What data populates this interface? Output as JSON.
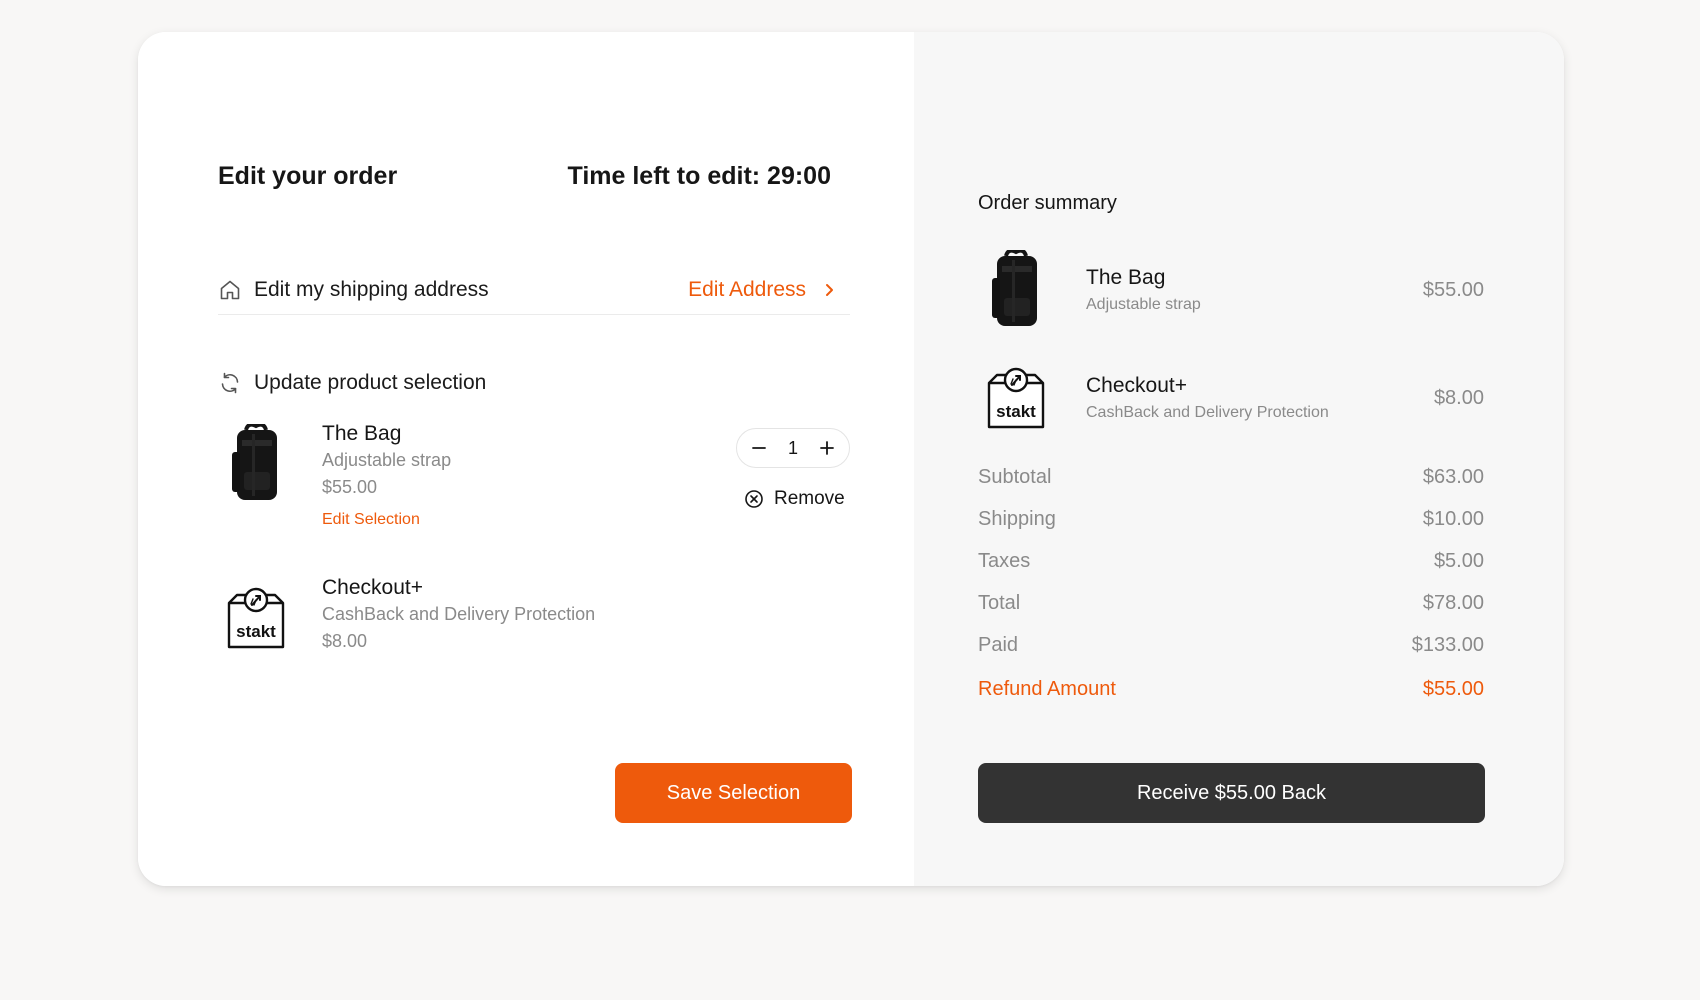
{
  "left": {
    "title": "Edit your order",
    "timer": "Time left to edit: 29:00",
    "shipping": {
      "label": "Edit my shipping address",
      "link": "Edit Address"
    },
    "update": {
      "label": "Update product selection"
    },
    "items": [
      {
        "name": "The Bag",
        "sub": "Adjustable strap",
        "price": "$55.00",
        "edit": "Edit Selection",
        "qty": "1",
        "remove": "Remove"
      },
      {
        "name": "Checkout+",
        "sub": "CashBack and Delivery Protection",
        "price": "$8.00"
      }
    ],
    "save_label": "Save Selection"
  },
  "right": {
    "title": "Order summary",
    "items": [
      {
        "name": "The Bag",
        "sub": "Adjustable strap",
        "price": "$55.00"
      },
      {
        "name": "Checkout+",
        "sub": "CashBack and Delivery Protection",
        "price": "$8.00"
      }
    ],
    "rows": [
      {
        "label": "Subtotal",
        "value": "$63.00"
      },
      {
        "label": "Shipping",
        "value": "$10.00"
      },
      {
        "label": "Taxes",
        "value": "$5.00"
      },
      {
        "label": "Total",
        "value": "$78.00"
      },
      {
        "label": "Paid",
        "value": "$133.00"
      }
    ],
    "refund": {
      "label": "Refund Amount",
      "value": "$55.00"
    },
    "receive_label": "Receive $55.00 Back"
  },
  "stakt_logo_text": "stakt",
  "colors": {
    "accent": "#ee5a0c",
    "dark_button": "#333333",
    "muted_text": "#8a8a8a"
  }
}
